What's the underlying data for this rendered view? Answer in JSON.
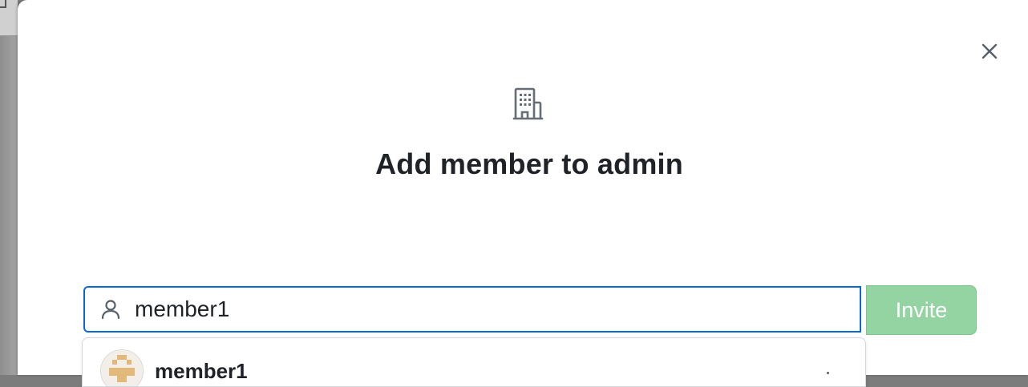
{
  "dialog": {
    "title": "Add member to admin",
    "icon": "organization-icon",
    "close_icon": "close-icon"
  },
  "search": {
    "icon": "person-icon",
    "value": "member1",
    "placeholder": ""
  },
  "invite": {
    "label": "Invite",
    "state": "disabled",
    "color": "#94d3a2"
  },
  "suggestions": [
    {
      "name": "member1",
      "avatar": "identicon-avatar"
    }
  ],
  "colors": {
    "focus_border": "#0969da",
    "text": "#1f2328",
    "icon": "#57606a"
  }
}
